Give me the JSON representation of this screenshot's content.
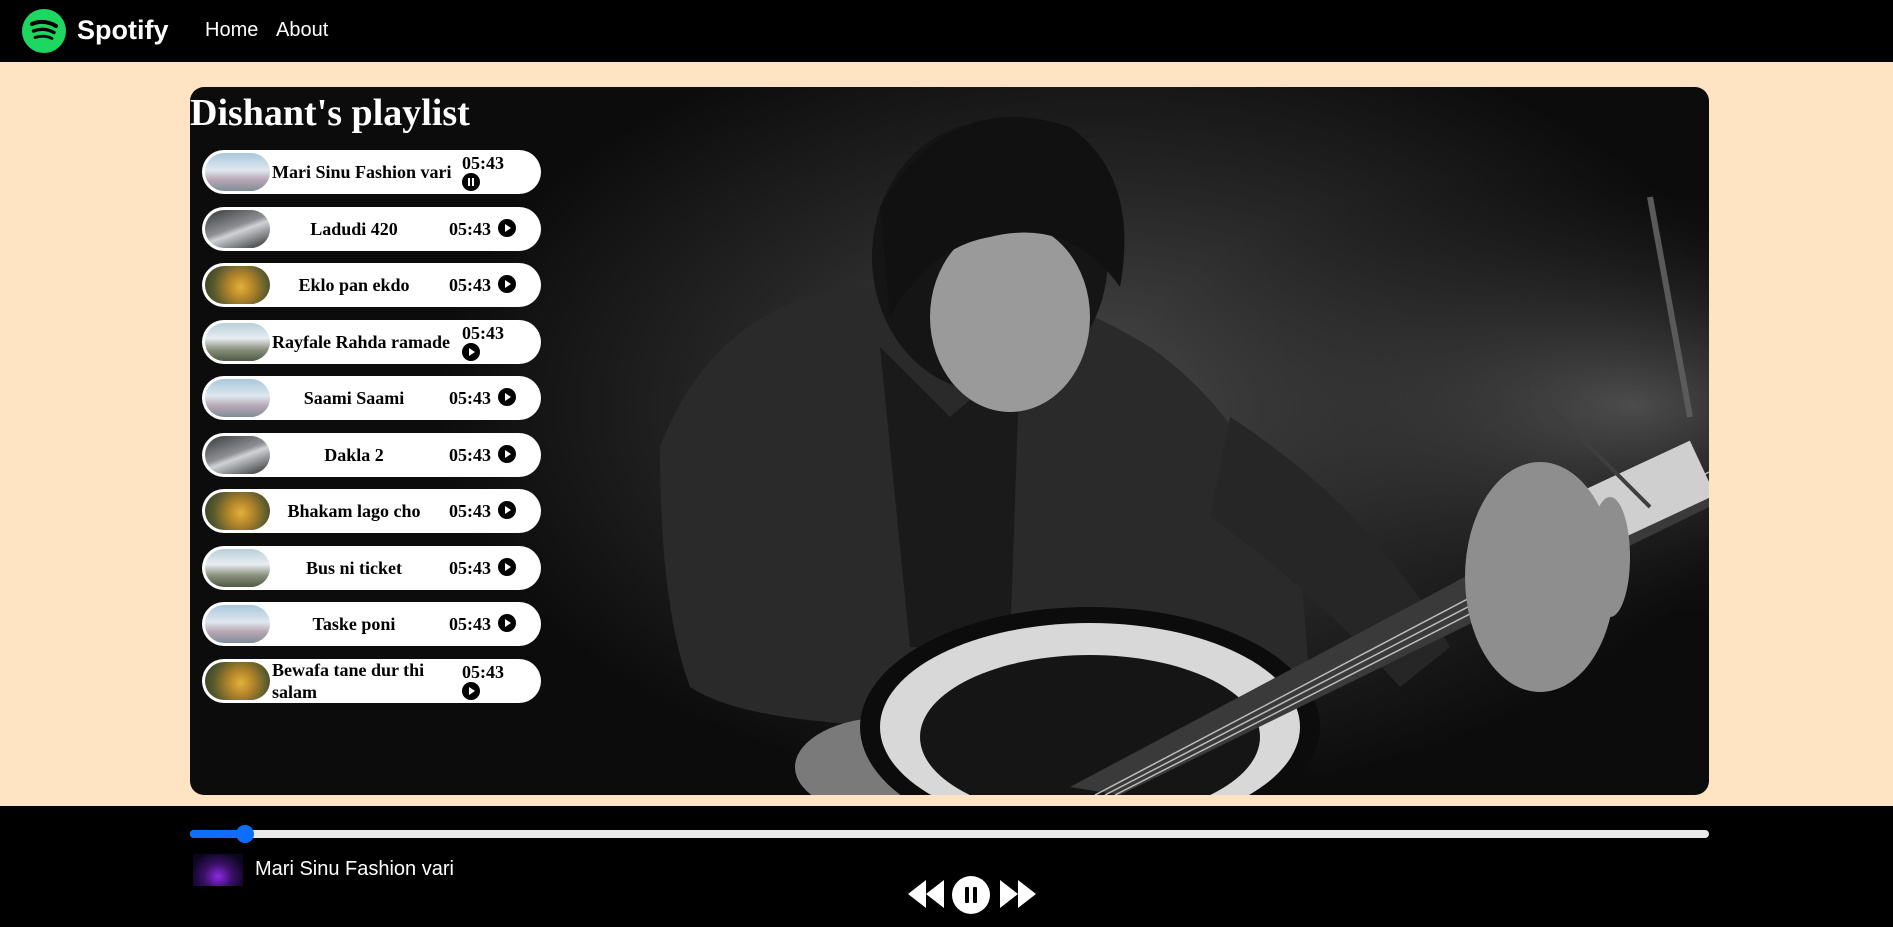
{
  "nav": {
    "brand": "Spotify",
    "links": [
      "Home",
      "About"
    ]
  },
  "playlist": {
    "title": "Dishant's playlist",
    "songs": [
      {
        "name": "Mari Sinu Fashion vari",
        "duration": "05:43",
        "state": "pause",
        "thumb": "mountain"
      },
      {
        "name": "Ladudi 420",
        "duration": "05:43",
        "state": "play",
        "thumb": "dark"
      },
      {
        "name": "Eklo pan ekdo",
        "duration": "05:43",
        "state": "play",
        "thumb": "gold"
      },
      {
        "name": "Rayfale Rahda ramade",
        "duration": "05:43",
        "state": "play",
        "thumb": "city"
      },
      {
        "name": "Saami Saami",
        "duration": "05:43",
        "state": "play",
        "thumb": "mountain"
      },
      {
        "name": "Dakla 2",
        "duration": "05:43",
        "state": "play",
        "thumb": "dark"
      },
      {
        "name": "Bhakam lago cho",
        "duration": "05:43",
        "state": "play",
        "thumb": "gold"
      },
      {
        "name": "Bus ni ticket",
        "duration": "05:43",
        "state": "play",
        "thumb": "city"
      },
      {
        "name": "Taske poni",
        "duration": "05:43",
        "state": "play",
        "thumb": "mountain"
      },
      {
        "name": "Bewafa tane dur thi salam",
        "duration": "05:43",
        "state": "play",
        "thumb": "gold"
      }
    ]
  },
  "player": {
    "now_playing": "Mari Sinu Fashion vari",
    "progress_percent": 3.6,
    "controls": [
      "backward-icon",
      "pause-icon",
      "forward-icon"
    ]
  },
  "colors": {
    "nav_bg": "#000000",
    "page_bg": "#ffe4c4",
    "brand_green": "#1ed760",
    "progress_blue": "#0d6efd"
  }
}
